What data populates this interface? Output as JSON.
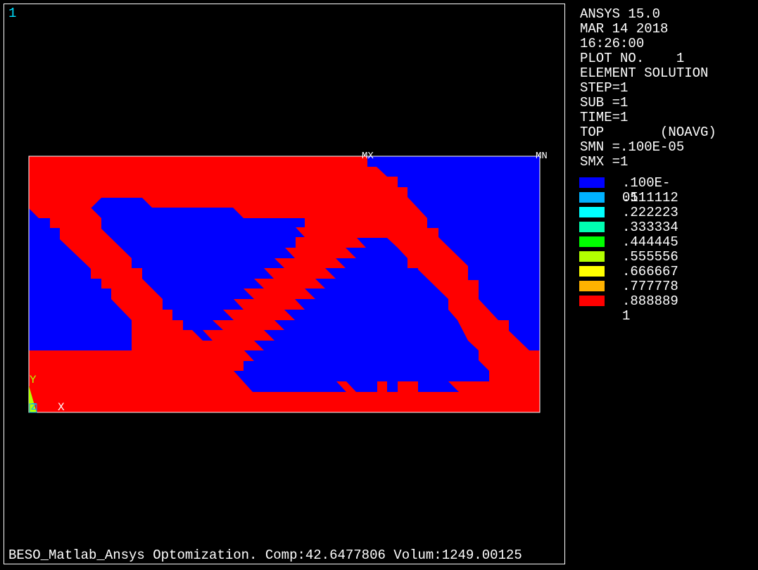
{
  "window_number": "1",
  "header": {
    "lines": [
      "ANSYS 15.0",
      "MAR 14 2018",
      "16:26:00",
      "PLOT NO.    1",
      "ELEMENT SOLUTION",
      "STEP=1",
      "SUB =1",
      "TIME=1",
      "TOP       (NOAVG)",
      "SMN =.100E-05",
      "SMX =1"
    ]
  },
  "legend": [
    {
      "label": ".100E-05",
      "color": "#0000ff"
    },
    {
      "label": ".111112",
      "color": "#00b2ff"
    },
    {
      "label": ".222223",
      "color": "#00ffff"
    },
    {
      "label": ".333334",
      "color": "#00ffb2"
    },
    {
      "label": ".444445",
      "color": "#00ff00"
    },
    {
      "label": ".555556",
      "color": "#b2ff00"
    },
    {
      "label": ".666667",
      "color": "#ffff00"
    },
    {
      "label": ".777778",
      "color": "#ffb200"
    },
    {
      "label": ".888889",
      "color": "#ff0000"
    },
    {
      "label": "1",
      "color": ""
    }
  ],
  "markers": {
    "max": "MX",
    "min": "MN"
  },
  "triad": {
    "x": "X",
    "y": "Y",
    "z": "Z"
  },
  "colors": {
    "solid": "#ff0000",
    "void": "#0000ff"
  },
  "caption": "BESO_Matlab_Ansys Optomization. Comp:42.6477806 Volum:1249.00125"
}
